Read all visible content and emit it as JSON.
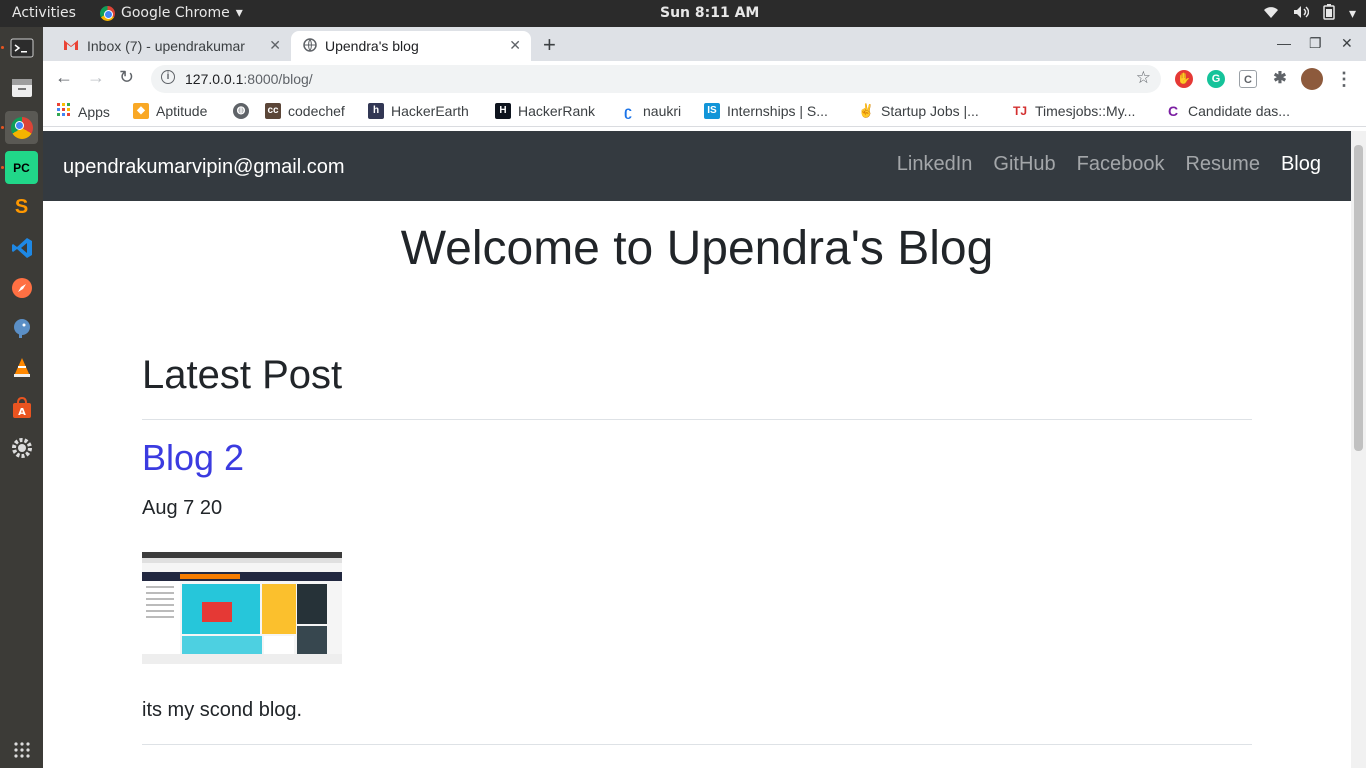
{
  "desktop": {
    "activities": "Activities",
    "app_menu": "Google Chrome",
    "clock": "Sun  8:11 AM"
  },
  "browser": {
    "tabs": [
      {
        "title": "Inbox (7) - upendrakumar",
        "icon": "gmail-icon",
        "active": false
      },
      {
        "title": "Upendra's blog",
        "icon": "globe-icon",
        "active": true
      }
    ],
    "url_host": "127.0.0.1",
    "url_path": ":8000/blog/",
    "bookmarks": [
      {
        "label": "Apps",
        "icon": "apps-grid-icon"
      },
      {
        "label": "Aptitude",
        "icon": "aptitude-icon"
      },
      {
        "label": "",
        "icon": "globe-icon"
      },
      {
        "label": "codechef",
        "icon": "codechef-icon"
      },
      {
        "label": "HackerEarth",
        "icon": "hackerearth-icon"
      },
      {
        "label": "HackerRank",
        "icon": "hackerrank-icon"
      },
      {
        "label": "naukri",
        "icon": "naukri-icon"
      },
      {
        "label": "Internships | S...",
        "icon": "internshala-icon"
      },
      {
        "label": "Startup Jobs |...",
        "icon": "angellist-icon"
      },
      {
        "label": "Timesjobs::My...",
        "icon": "timesjobs-icon"
      },
      {
        "label": "Candidate das...",
        "icon": "candidate-icon"
      }
    ]
  },
  "site": {
    "brand": "upendrakumarvipin@gmail.com",
    "nav": [
      "LinkedIn",
      "GitHub",
      "Facebook",
      "Resume",
      "Blog"
    ],
    "hero": "Welcome to Upendra's Blog",
    "section_title": "Latest Post",
    "post": {
      "title": "Blog 2",
      "date": "Aug 7 20",
      "body": "its my scond blog."
    }
  },
  "colors": {
    "navbar_bg": "#343a40",
    "link": "#3b3be0",
    "dock_bg": "#3c3b37",
    "topbar_bg": "#2b2b2b"
  }
}
